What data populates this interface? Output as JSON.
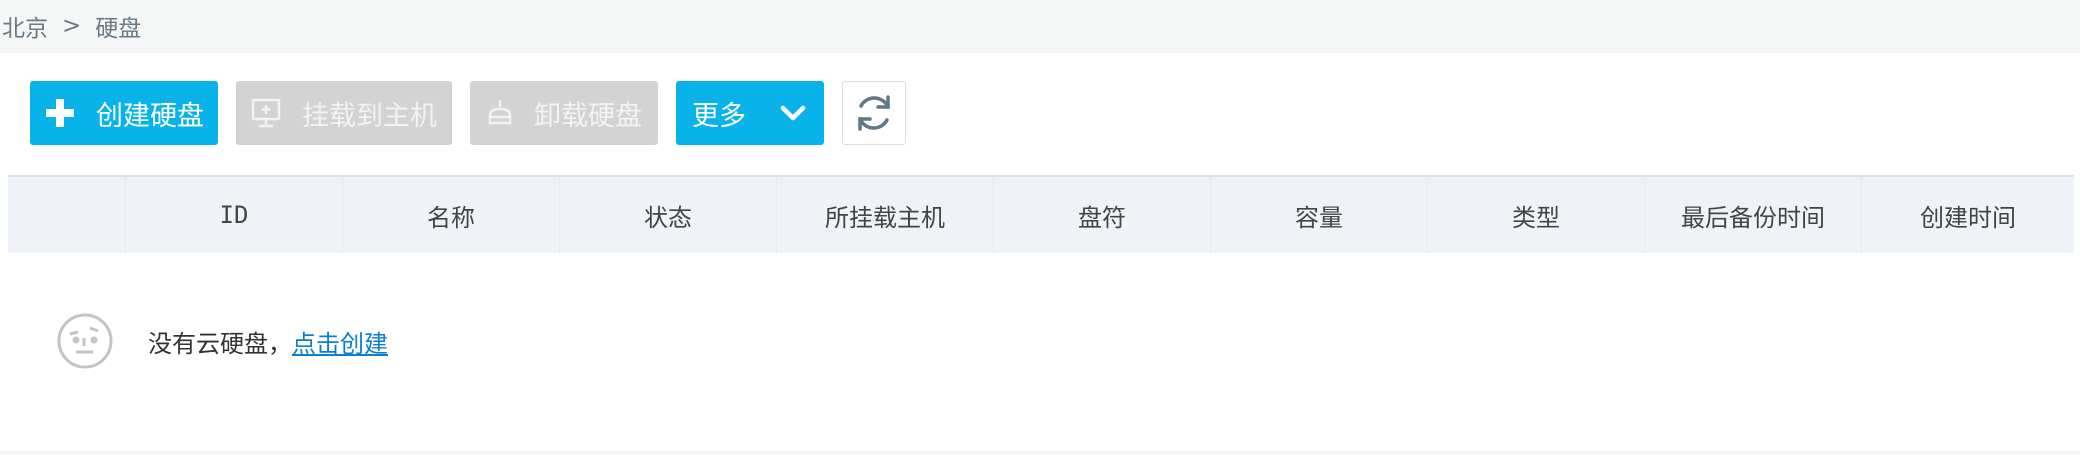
{
  "breadcrumb": {
    "parent": "北京",
    "separator": ">",
    "current": "硬盘"
  },
  "toolbar": {
    "create_label": "创建硬盘",
    "attach_label": "挂载到主机",
    "detach_label": "卸载硬盘",
    "more_label": "更多"
  },
  "table": {
    "columns": [
      "",
      "ID",
      "名称",
      "状态",
      "所挂载主机",
      "盘符",
      "容量",
      "类型",
      "最后备份时间",
      "创建时间"
    ]
  },
  "empty": {
    "message": "没有云硬盘，",
    "link": "点击创建"
  },
  "colors": {
    "primary": "#08b3e9",
    "disabled": "#d3d3d3",
    "link": "#0a7fd0",
    "header_bg": "#eff3f8"
  }
}
